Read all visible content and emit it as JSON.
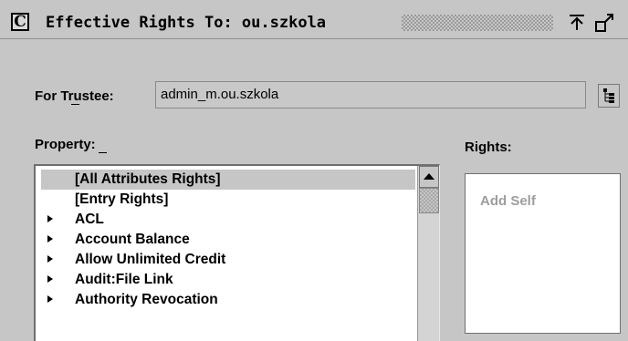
{
  "window": {
    "title": "Effective Rights To: ou.szkola",
    "app_icon": "C",
    "buttons": [
      "maximize-icon",
      "restore-icon"
    ]
  },
  "trustee": {
    "label": "For Trustee:",
    "value": "admin_m.ou.szkola",
    "browse_icon": "tree-browse-icon"
  },
  "property": {
    "label": "Property:",
    "items": [
      {
        "label": "[All Attributes Rights]",
        "expandable": false,
        "selected": true
      },
      {
        "label": "[Entry Rights]",
        "expandable": false,
        "selected": false
      },
      {
        "label": "ACL",
        "expandable": true,
        "selected": false
      },
      {
        "label": "Account Balance",
        "expandable": true,
        "selected": false
      },
      {
        "label": "Allow Unlimited Credit",
        "expandable": true,
        "selected": false
      },
      {
        "label": "Audit:File Link",
        "expandable": true,
        "selected": false
      },
      {
        "label": "Authority Revocation",
        "expandable": true,
        "selected": false
      }
    ]
  },
  "rights": {
    "label": "Rights:",
    "items": [
      "Add Self"
    ]
  },
  "colors": {
    "background": "#c6c6c6",
    "selection": "#c6c6c6",
    "disabled_text": "#9d9d9d"
  }
}
